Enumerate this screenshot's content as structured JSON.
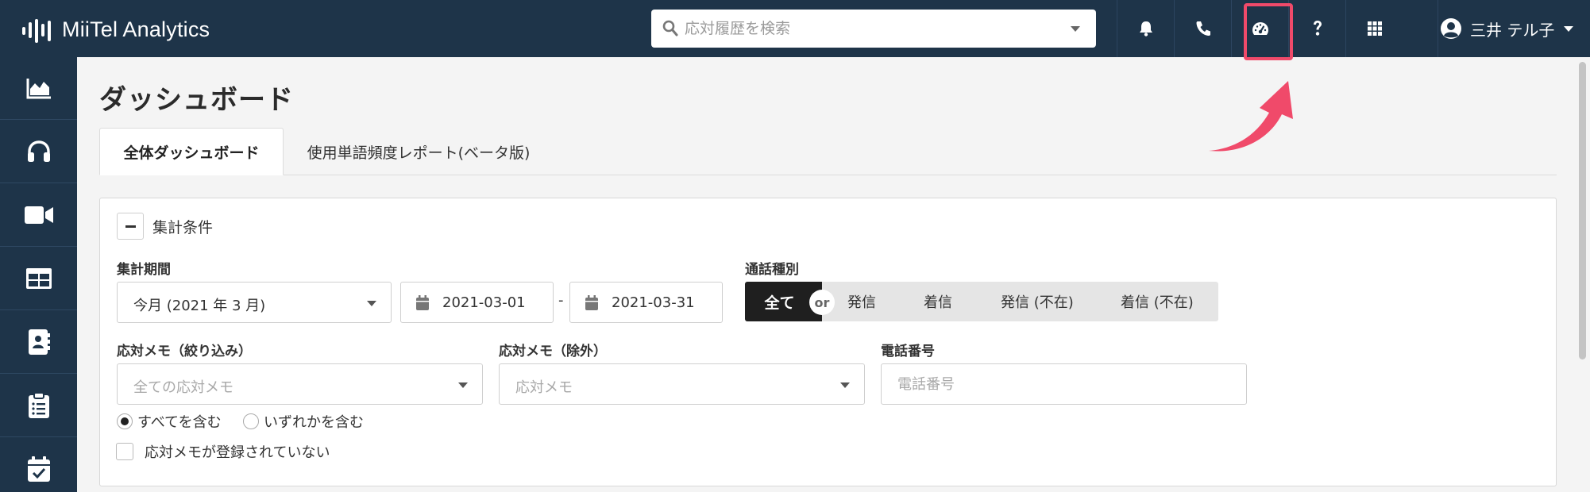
{
  "app": {
    "logo_text": "MiiTel Analytics"
  },
  "search": {
    "placeholder": "応対履歴を検索"
  },
  "topbar": {
    "icons": [
      "bell-icon",
      "phone-icon",
      "dashboard-gauge-icon",
      "help-icon",
      "apps-grid-icon"
    ],
    "user_name": "三井 テル子"
  },
  "sidebar": {
    "items": [
      "chart-area-icon",
      "headset-icon",
      "video-icon",
      "table-icon",
      "contact-book-icon",
      "clipboard-list-icon",
      "calendar-check-icon"
    ]
  },
  "page": {
    "title": "ダッシュボード",
    "tabs": [
      {
        "label": "全体ダッシュボード",
        "active": true
      },
      {
        "label": "使用単語頻度レポート(ベータ版)",
        "active": false
      }
    ]
  },
  "filters": {
    "title": "集計条件",
    "period": {
      "label": "集計期間",
      "preset": "今月 (2021 年 3 月)",
      "start": "2021-03-01",
      "separator": "-",
      "end": "2021-03-31"
    },
    "call_type": {
      "label": "通話種別",
      "all": "全て",
      "or": "or",
      "options": [
        "発信",
        "着信",
        "発信 (不在)",
        "着信 (不在)"
      ]
    },
    "memo_include": {
      "label": "応対メモ（絞り込み）",
      "placeholder": "全ての応対メモ"
    },
    "memo_exclude": {
      "label": "応対メモ（除外）",
      "placeholder": "応対メモ"
    },
    "phone": {
      "label": "電話番号",
      "placeholder": "電話番号"
    },
    "match_mode": {
      "all": "すべてを含む",
      "any": "いずれかを含む",
      "selected": "all"
    },
    "no_memo": {
      "label": "応対メモが登録されていない",
      "checked": false
    }
  },
  "colors": {
    "nav_bg": "#1e3449",
    "highlight": "#f04a6a",
    "segment_active": "#1f1f1f"
  }
}
